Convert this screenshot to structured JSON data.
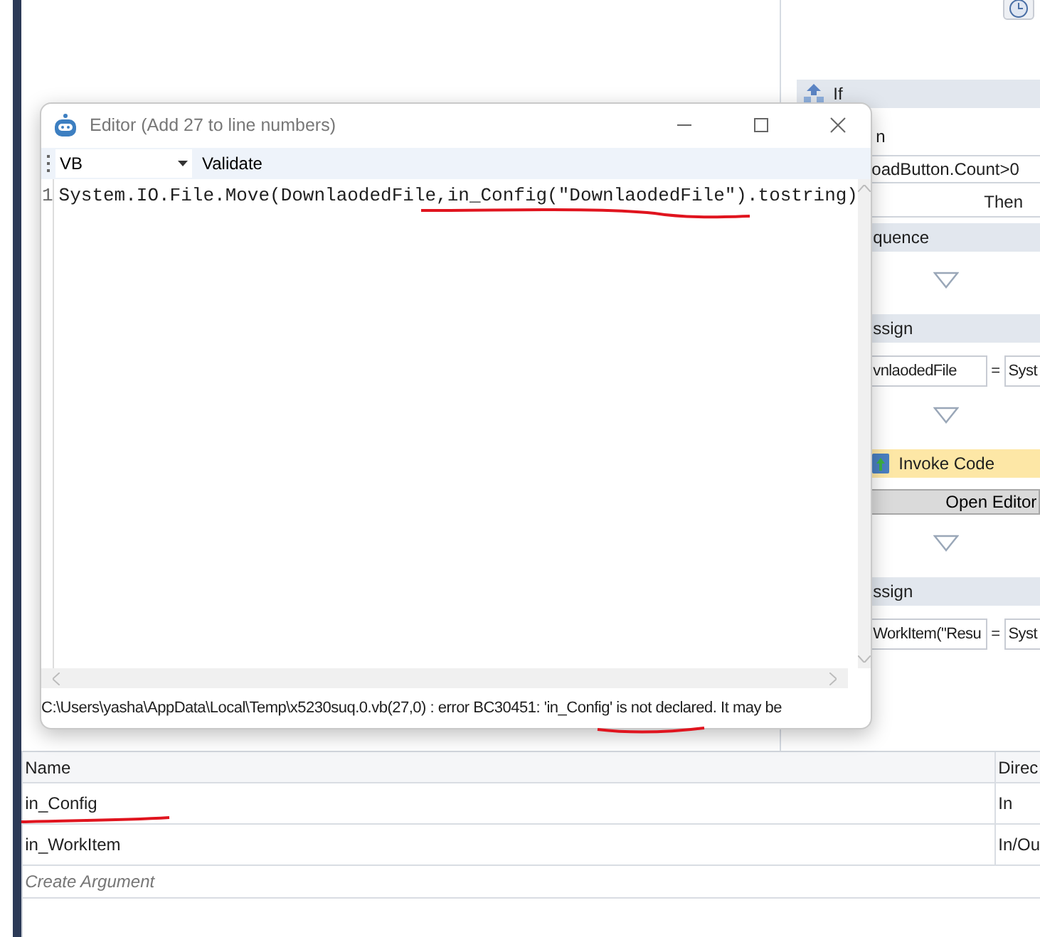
{
  "window": {
    "title": "Editor (Add 27 to line numbers)"
  },
  "editor": {
    "language": "VB",
    "validate": "Validate",
    "lines": [
      {
        "number": "1",
        "code": "System.IO.File.Move(DownlaodedFile,in_Config(\"DownlaodedFile\").tostring)"
      }
    ],
    "error": "C:\\Users\\yasha\\AppData\\Local\\Temp\\x5230suq.0.vb(27,0) : error BC30451: 'in_Config' is not declared. It may be"
  },
  "designer": {
    "items": [
      {
        "kind": "if",
        "label": "If"
      },
      {
        "kind": "label",
        "label": "n"
      },
      {
        "kind": "field",
        "value": "oadButton.Count>0"
      },
      {
        "kind": "then",
        "label": "Then"
      },
      {
        "kind": "section",
        "label": "quence"
      },
      {
        "kind": "connector"
      },
      {
        "kind": "section",
        "label": "ssign"
      },
      {
        "kind": "assign",
        "target": "vnlaodedFile",
        "operator": "=",
        "value": "Syst"
      },
      {
        "kind": "connector"
      },
      {
        "kind": "invoke",
        "label": "Invoke Code"
      },
      {
        "kind": "button",
        "label": "Open Editor"
      },
      {
        "kind": "connector"
      },
      {
        "kind": "section",
        "label": "ssign"
      },
      {
        "kind": "assign",
        "target": "WorkItem(\"Resu",
        "operator": "=",
        "value": "Syst"
      }
    ]
  },
  "arguments": {
    "columns": [
      "Name",
      "Direc"
    ],
    "rows": [
      {
        "name": "in_Config",
        "direction": "In"
      },
      {
        "name": "in_WorkItem",
        "direction": "In/Ou"
      }
    ],
    "create": "Create Argument"
  }
}
